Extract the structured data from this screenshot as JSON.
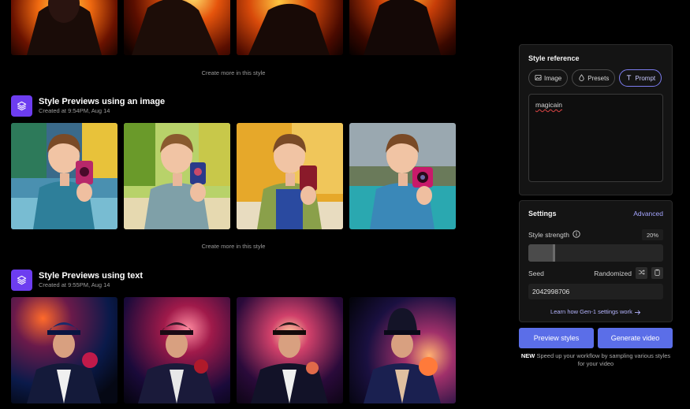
{
  "gallery": {
    "create_more_label": "Create more in this style",
    "sections": [
      {
        "title": "Style Previews using an image",
        "created": "Created at 9:54PM, Aug 14"
      },
      {
        "title": "Style Previews using text",
        "created": "Created at 9:55PM, Aug 14"
      }
    ]
  },
  "style_reference": {
    "title": "Style reference",
    "tabs": [
      {
        "label": "Image",
        "icon": "image-icon"
      },
      {
        "label": "Presets",
        "icon": "drop-icon"
      },
      {
        "label": "Prompt",
        "icon": "text-icon"
      }
    ],
    "active_tab": "Prompt",
    "prompt_value": "magicain"
  },
  "settings": {
    "title": "Settings",
    "advanced_label": "Advanced",
    "style_strength_label": "Style strength",
    "style_strength_value": "20%",
    "style_strength_fraction": 0.2,
    "seed_label": "Seed",
    "randomized_label": "Randomized",
    "seed_value": "2042998706",
    "learn_link": "Learn how Gen-1 settings work"
  },
  "actions": {
    "preview_label": "Preview styles",
    "generate_label": "Generate video"
  },
  "footnote": {
    "badge": "NEW",
    "text": "Speed up your workflow by sampling various styles for your video"
  },
  "colors": {
    "accent": "#5b6ee8",
    "badge": "#6d3df0",
    "panel": "#141414"
  }
}
